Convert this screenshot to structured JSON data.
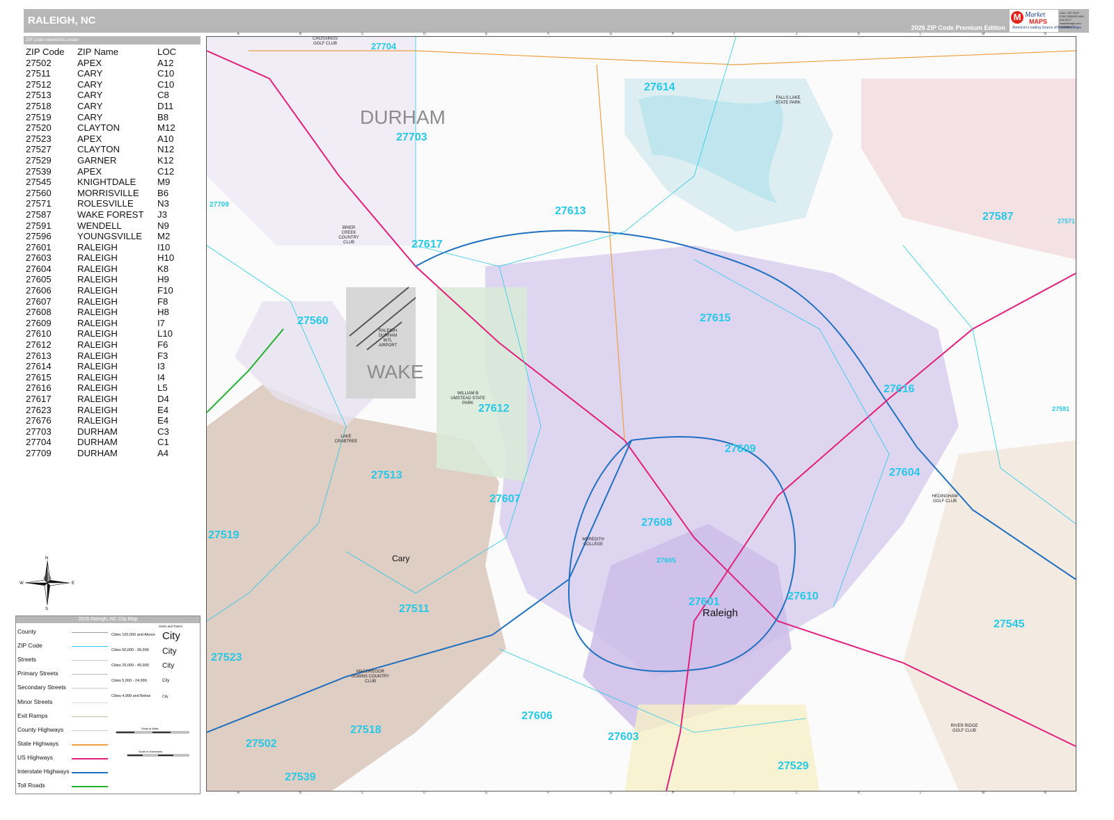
{
  "header": {
    "title": "RALEIGH, NC",
    "edition": "2026 ZIP Code Premium Edition",
    "logo_line1": "Market",
    "logo_line2": "MAPS",
    "logo_tag": "America's Leading Source of Business Maps",
    "code_text": "CALL OR TEXT FOR ORDERS\n800-334-3477\nmarketmaps.com\nC00985XQ"
  },
  "index": {
    "header": "ZIP Code Index/Grid Locator",
    "columns": [
      "ZIP Code",
      "ZIP Name",
      "LOC"
    ],
    "rows": [
      [
        "27502",
        "APEX",
        "A12"
      ],
      [
        "27511",
        "CARY",
        "C10"
      ],
      [
        "27512",
        "CARY",
        "C10"
      ],
      [
        "27513",
        "CARY",
        "C8"
      ],
      [
        "27518",
        "CARY",
        "D11"
      ],
      [
        "27519",
        "CARY",
        "B8"
      ],
      [
        "27520",
        "CLAYTON",
        "M12"
      ],
      [
        "27523",
        "APEX",
        "A10"
      ],
      [
        "27527",
        "CLAYTON",
        "N12"
      ],
      [
        "27529",
        "GARNER",
        "K12"
      ],
      [
        "27539",
        "APEX",
        "C12"
      ],
      [
        "27545",
        "KNIGHTDALE",
        "M9"
      ],
      [
        "27560",
        "MORRISVILLE",
        "B6"
      ],
      [
        "27571",
        "ROLESVILLE",
        "N3"
      ],
      [
        "27587",
        "WAKE FOREST",
        "J3"
      ],
      [
        "27591",
        "WENDELL",
        "N9"
      ],
      [
        "27596",
        "YOUNGSVILLE",
        "M2"
      ],
      [
        "27601",
        "RALEIGH",
        "I10"
      ],
      [
        "27603",
        "RALEIGH",
        "H10"
      ],
      [
        "27604",
        "RALEIGH",
        "K8"
      ],
      [
        "27605",
        "RALEIGH",
        "H9"
      ],
      [
        "27606",
        "RALEIGH",
        "F10"
      ],
      [
        "27607",
        "RALEIGH",
        "F8"
      ],
      [
        "27608",
        "RALEIGH",
        "H8"
      ],
      [
        "27609",
        "RALEIGH",
        "I7"
      ],
      [
        "27610",
        "RALEIGH",
        "L10"
      ],
      [
        "27612",
        "RALEIGH",
        "F6"
      ],
      [
        "27613",
        "RALEIGH",
        "F3"
      ],
      [
        "27614",
        "RALEIGH",
        "I3"
      ],
      [
        "27615",
        "RALEIGH",
        "I4"
      ],
      [
        "27616",
        "RALEIGH",
        "L5"
      ],
      [
        "27617",
        "RALEIGH",
        "D4"
      ],
      [
        "27623",
        "RALEIGH",
        "E4"
      ],
      [
        "27676",
        "RALEIGH",
        "E4"
      ],
      [
        "27703",
        "DURHAM",
        "C3"
      ],
      [
        "27704",
        "DURHAM",
        "C1"
      ],
      [
        "27709",
        "DURHAM",
        "A4"
      ]
    ]
  },
  "compass": {
    "n": "N",
    "s": "S",
    "e": "E",
    "w": "W"
  },
  "legend": {
    "title": "2026 Raleigh, NC City Map",
    "cities_header": "Cities and Towns",
    "items": [
      "County",
      "ZIP Code",
      "Streets",
      "Primary Streets",
      "Secondary Streets",
      "Minor Streets",
      "Exit Ramps",
      "County Highways",
      "State Highways",
      "US Highways",
      "Interstate Highways",
      "Toll Roads"
    ],
    "colors": [
      "#9a9a9a",
      "#27c8e6",
      "#cccccc",
      "#bbbbbb",
      "#cccccc",
      "#dddddd",
      "#c9b8a2",
      "#cccccc",
      "#f0a040",
      "#e0207a",
      "#1f6fc0",
      "#21b02c"
    ],
    "city_sizes": [
      {
        "label": "Cities 100,000 and Above",
        "sample": "City"
      },
      {
        "label": "Cities 50,000 - 99,999",
        "sample": "City"
      },
      {
        "label": "Cities 25,000 - 49,999",
        "sample": "City"
      },
      {
        "label": "Cities 5,000 - 24,999",
        "sample": "City"
      },
      {
        "label": "Cities 4,999 and Below",
        "sample": "City"
      }
    ],
    "scale_miles": "Scale in Miles",
    "scale_km": "Scale in Kilometers"
  },
  "map": {
    "grid_cols": [
      "A",
      "B",
      "C",
      "D",
      "E",
      "F",
      "G",
      "H",
      "I",
      "J",
      "K",
      "L",
      "M",
      "N"
    ],
    "zips": [
      {
        "code": "27704"
      },
      {
        "code": "27614"
      },
      {
        "code": "27703"
      },
      {
        "code": "27613"
      },
      {
        "code": "27587"
      },
      {
        "code": "27617"
      },
      {
        "code": "27709"
      },
      {
        "code": "27560"
      },
      {
        "code": "27615"
      },
      {
        "code": "27616"
      },
      {
        "code": "27612"
      },
      {
        "code": "27609"
      },
      {
        "code": "27513"
      },
      {
        "code": "27604"
      },
      {
        "code": "27607"
      },
      {
        "code": "27608"
      },
      {
        "code": "27519"
      },
      {
        "code": "27605"
      },
      {
        "code": "27511"
      },
      {
        "code": "27601"
      },
      {
        "code": "27610"
      },
      {
        "code": "27545"
      },
      {
        "code": "27523"
      },
      {
        "code": "27606"
      },
      {
        "code": "27603"
      },
      {
        "code": "27518"
      },
      {
        "code": "27502"
      },
      {
        "code": "27539"
      },
      {
        "code": "27529"
      },
      {
        "code": "27591"
      },
      {
        "code": "27571"
      }
    ],
    "counties": [
      "DURHAM",
      "WAKE"
    ],
    "cities": [
      "Cary",
      "Raleigh"
    ],
    "parks": [
      "FALLS LAKE STATE PARK",
      "WILLIAM B UMSTEAD STATE PARK",
      "RALEIGH DURHAM INTL AIRPORT",
      "MACGREGOR DOWNS COUNTRY CLUB",
      "RIVER RIDGE GOLF CLUB",
      "LAKE CRABTREE",
      "MEREDITH COLLEGE",
      "HEDINGHAM GOLF CLUB",
      "CROSSINGS GOLF CLUB",
      "BRIER CREEK COUNTRY CLUB"
    ]
  }
}
